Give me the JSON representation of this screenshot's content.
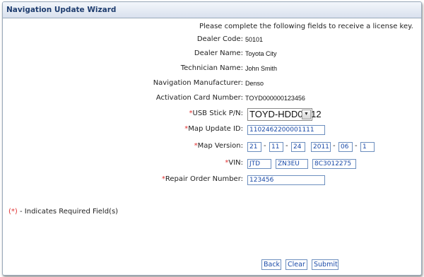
{
  "window": {
    "title": "Navigation Update Wizard"
  },
  "intro": "Please complete the following fields to receive a license key.",
  "dealer_code": {
    "label": "Dealer Code:",
    "value": "50101"
  },
  "dealer_name": {
    "label": "Dealer Name:",
    "value": "Toyota City"
  },
  "technician_name": {
    "label": "Technician Name:",
    "value": "John Smith"
  },
  "nav_manufacturer": {
    "label": "Navigation Manufacturer:",
    "value": "Denso"
  },
  "activation_card": {
    "label": "Activation Card Number:",
    "value": "TOYD000000123456"
  },
  "usb_stick": {
    "required_mark": "*",
    "label": "USB Stick P/N:",
    "value": "TOYD-HDD07-12"
  },
  "map_update_id": {
    "required_mark": "*",
    "label": "Map Update ID:",
    "value": "1102462200001111"
  },
  "map_version": {
    "required_mark": "*",
    "label": "Map Version:",
    "parts": [
      "21",
      "11",
      "24",
      "2011",
      "06",
      "1"
    ],
    "separator": "-"
  },
  "vin": {
    "required_mark": "*",
    "label": "VIN:",
    "parts": [
      "JTD",
      "ZN3EU",
      "8C3012275"
    ]
  },
  "repair_order": {
    "required_mark": "*",
    "label": "Repair Order Number:",
    "value": "123456"
  },
  "footnote": {
    "mark": "(*)",
    "text": " - Indicates Required Field(s)"
  },
  "buttons": {
    "back": "Back",
    "clear": "Clear",
    "submit": "Submit"
  },
  "colors": {
    "required": "#e03030",
    "title": "#1e3c6e",
    "input_border": "#6d8fbf",
    "input_text": "#1a4aa8"
  }
}
